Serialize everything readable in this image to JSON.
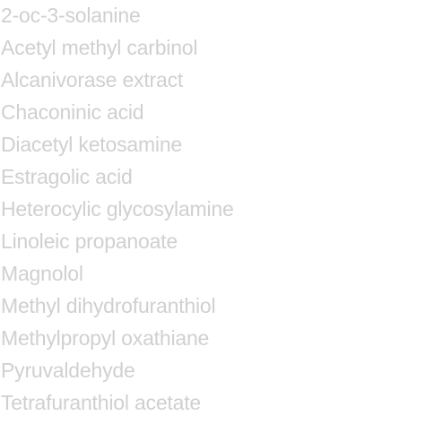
{
  "list": {
    "items": [
      "2-oc-3-solanine",
      "Acetyl methyl carbinol",
      "Alcanivorase extract",
      "Chaconinic acid",
      "Diacetyl ketosamine",
      "Estragolic acid",
      "Heterocylic glycosylamine",
      "Linoleic propanoate",
      "Magnolol",
      "Methyl dihydrofuranthiol",
      "Methylpropyl oxathiane",
      "Pyruvaldehyde",
      "Tetrafuranthiol acetate"
    ]
  },
  "colors": {
    "text": "#d0d0d0",
    "background": "#ffffff"
  }
}
